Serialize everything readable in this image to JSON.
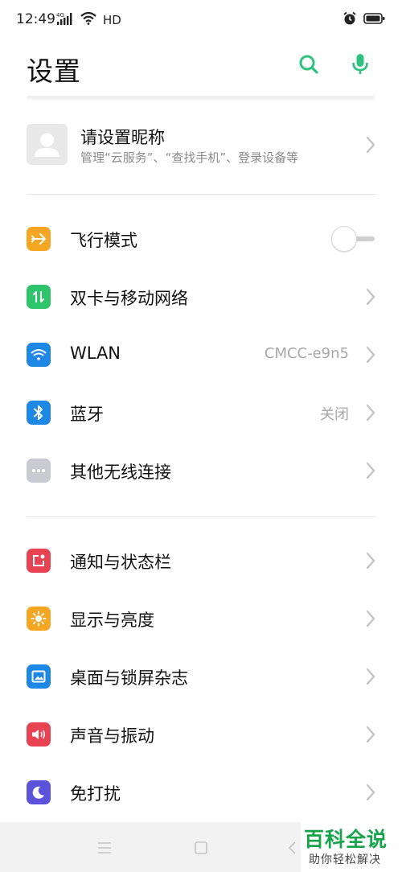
{
  "status_bar": {
    "time": "12:49",
    "network": "HD"
  },
  "header": {
    "title": "设置"
  },
  "account": {
    "name": "请设置昵称",
    "subtitle": "管理“云服务”、“查找手机”、登录设备等"
  },
  "section1": [
    {
      "label": "飞行模式",
      "icon": "airplane-icon",
      "color": "#F5A623",
      "toggle": false
    },
    {
      "label": "双卡与移动网络",
      "icon": "dual-sim-icon",
      "color": "#2FC46B"
    },
    {
      "label": "WLAN",
      "icon": "wifi-icon",
      "color": "#1E88E5",
      "value": "CMCC-e9n5"
    },
    {
      "label": "蓝牙",
      "icon": "bluetooth-icon",
      "color": "#1E88E5",
      "value": "关闭"
    },
    {
      "label": "其他无线连接",
      "icon": "more-connections-icon",
      "color": "#C9CAD2"
    }
  ],
  "section2": [
    {
      "label": "通知与状态栏",
      "icon": "notification-icon",
      "color": "#E84352"
    },
    {
      "label": "显示与亮度",
      "icon": "brightness-icon",
      "color": "#F5A623"
    },
    {
      "label": "桌面与锁屏杂志",
      "icon": "wallpaper-icon",
      "color": "#1E88E5"
    },
    {
      "label": "声音与振动",
      "icon": "sound-icon",
      "color": "#E84352"
    },
    {
      "label": "免打扰",
      "icon": "do-not-disturb-icon",
      "color": "#5B53D9"
    }
  ],
  "colors": {
    "accent": "#2EC27E",
    "chevron": "#C4C4C4",
    "divider": "#E6E6E6"
  },
  "watermark": {
    "title": "百科全说",
    "subtitle": "助你轻松解决"
  }
}
